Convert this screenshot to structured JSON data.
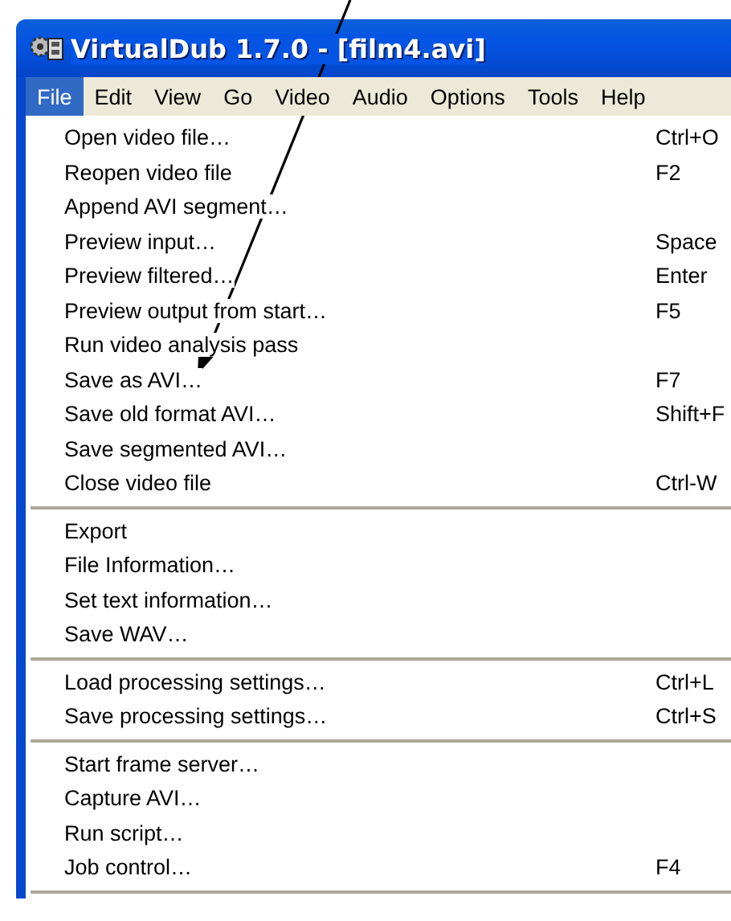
{
  "window": {
    "title": "VirtualDub 1.7.0 - [film4.avi]"
  },
  "menu_bar": [
    {
      "label": "File",
      "selected": true
    },
    {
      "label": "Edit",
      "selected": false
    },
    {
      "label": "View",
      "selected": false
    },
    {
      "label": "Go",
      "selected": false
    },
    {
      "label": "Video",
      "selected": false
    },
    {
      "label": "Audio",
      "selected": false
    },
    {
      "label": "Options",
      "selected": false
    },
    {
      "label": "Tools",
      "selected": false
    },
    {
      "label": "Help",
      "selected": false
    }
  ],
  "file_menu": {
    "groups": [
      [
        {
          "label": "Open video file…",
          "shortcut": "Ctrl+O"
        },
        {
          "label": "Reopen video file",
          "shortcut": "F2"
        },
        {
          "label": "Append AVI segment…"
        },
        {
          "label": "Preview input…",
          "shortcut": "Space"
        },
        {
          "label": "Preview filtered…",
          "shortcut": "Enter"
        },
        {
          "label": "Preview output from start…",
          "shortcut": "F5"
        },
        {
          "label": "Run video analysis pass"
        },
        {
          "label": "Save as AVI…",
          "shortcut": "F7"
        },
        {
          "label": "Save old format AVI…",
          "shortcut": "Shift+F"
        },
        {
          "label": "Save segmented AVI…"
        },
        {
          "label": "Close video file",
          "shortcut": "Ctrl-W"
        }
      ],
      [
        {
          "label": "Export"
        },
        {
          "label": "File Information…"
        },
        {
          "label": "Set text information…"
        },
        {
          "label": "Save WAV…"
        }
      ],
      [
        {
          "label": "Load processing settings…",
          "shortcut": "Ctrl+L"
        },
        {
          "label": "Save processing settings…",
          "shortcut": "Ctrl+S"
        }
      ],
      [
        {
          "label": "Start frame server…"
        },
        {
          "label": "Capture AVI…"
        },
        {
          "label": "Run script…"
        },
        {
          "label": "Job control…",
          "shortcut": "F4"
        }
      ]
    ]
  }
}
